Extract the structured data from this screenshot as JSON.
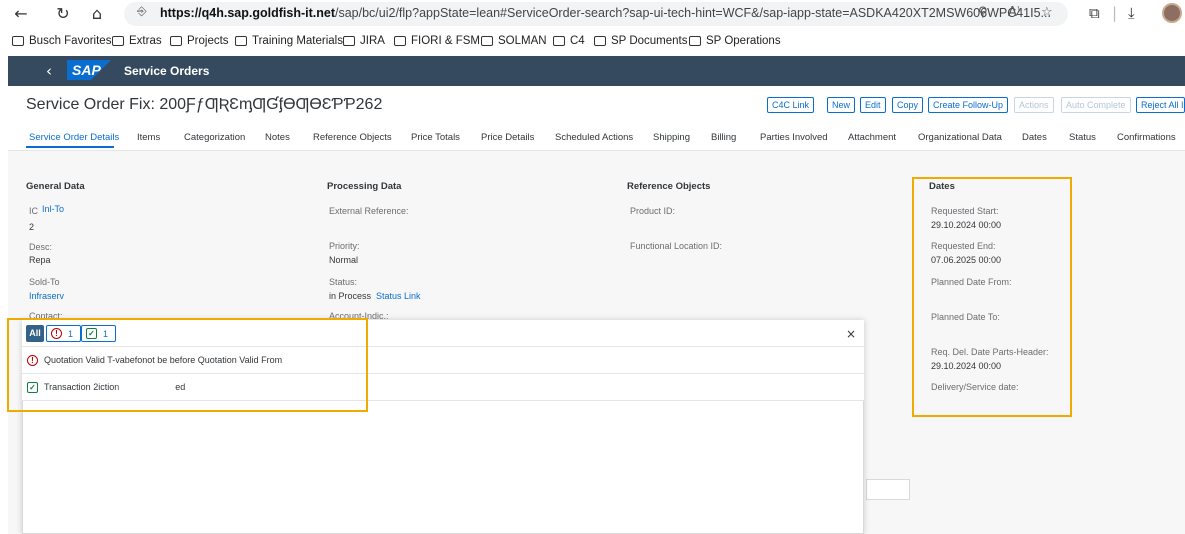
{
  "browser": {
    "back_icon": "arrow-left-icon",
    "reload_icon": "reload-icon",
    "home_icon": "home-icon",
    "url_host": "https://q4h.sap.goldfish-it.net",
    "url_rest": "/sap/bc/ui2/flp?appState=lean#ServiceOrder-search?sap-ui-tech-hint=WCF&/sap-iapp-state=ASDKA420XT2MSW606WPC41I5..."
  },
  "favorites": [
    "Busch Favorites",
    "Extras",
    "Projects",
    "Training Materials",
    "JIRA",
    "FIORI & FSM",
    "SOLMAN",
    "C4",
    "SP Documents",
    "SP Operations"
  ],
  "shell": {
    "logo": "SAP",
    "title": "Service Orders"
  },
  "header": {
    "title": "Service Order Fix: 200ƑƒƢƦƐᶆƢƓᶂƟƢƟƐƤƤ262",
    "buttons": [
      {
        "label": "C4C Link",
        "disabled": false
      },
      {
        "label": "New",
        "disabled": false
      },
      {
        "label": "Edit",
        "disabled": false
      },
      {
        "label": "Copy",
        "disabled": false
      },
      {
        "label": "Create Follow-Up",
        "disabled": false
      },
      {
        "label": "Actions",
        "disabled": true
      },
      {
        "label": "Auto Complete",
        "disabled": true
      },
      {
        "label": "Reject All I",
        "disabled": false
      }
    ]
  },
  "tabs": [
    "Service Order Details",
    "Items",
    "Categorization",
    "Notes",
    "Reference Objects",
    "Price Totals",
    "Price Details",
    "Scheduled Actions",
    "Shipping",
    "Billing",
    "Parties Involved",
    "Attachment",
    "Organizational Data",
    "Dates",
    "Status",
    "Confirmations"
  ],
  "sections": {
    "general": {
      "title": "General Data",
      "id_label": "IC",
      "id_link": "Inl-To",
      "id_value": "2",
      "desc_label": "Desc:",
      "desc_value": "Repa",
      "sold_label": "Sold-To",
      "sold_value": "Infraserv",
      "contact_label": "Contact:"
    },
    "processing": {
      "title": "Processing Data",
      "ext_ref_label": "External Reference:",
      "priority_label": "Priority:",
      "priority_value": "Normal",
      "status_label": "Status:",
      "status_value": "in Process",
      "status_link": "Status Link",
      "account_label": "Account-Indic.:"
    },
    "reference": {
      "title": "Reference Objects",
      "product_label": "Product ID:",
      "funcloc_label": "Functional Location ID:"
    },
    "dates": {
      "title": "Dates",
      "req_start_label": "Requested Start:",
      "req_start_value": "29.10.2024  00:00",
      "req_end_label": "Requested End:",
      "req_end_value": "07.06.2025  00:00",
      "planned_from_label": "Planned Date From:",
      "planned_to_label": "Planned Date To:",
      "req_del_label": "Req. Del. Date Parts-Header:",
      "req_del_value": "29.10.2024  00:00",
      "delivery_label": "Delivery/Service date:"
    }
  },
  "messages": {
    "tab_all": "All",
    "error_count": "1",
    "success_count": "1",
    "error_text": "Quotation Valid T-vabefonot be before Quotation Valid From",
    "success_text": "Transaction 2iction",
    "success_text_tail": "ed",
    "close_icon": "close-icon"
  }
}
